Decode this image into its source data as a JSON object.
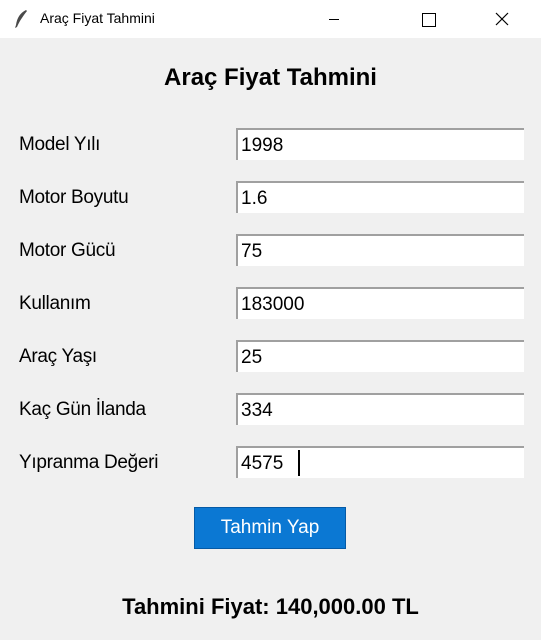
{
  "window": {
    "title": "Araç Fiyat Tahmini",
    "controls": [
      "minimize-icon",
      "maximize-icon",
      "close-icon"
    ]
  },
  "heading": "Araç Fiyat Tahmini",
  "fields": [
    {
      "label": "Model Yılı",
      "value": "1998"
    },
    {
      "label": "Motor Boyutu",
      "value": "1.6"
    },
    {
      "label": "Motor Gücü",
      "value": "75"
    },
    {
      "label": "Kullanım",
      "value": "183000"
    },
    {
      "label": "Araç Yaşı",
      "value": "25"
    },
    {
      "label": "Kaç Gün İlanda",
      "value": "334"
    },
    {
      "label": "Yıpranma Değeri",
      "value": "4575"
    }
  ],
  "button": {
    "label": "Tahmin Yap",
    "color": "#0b78d3"
  },
  "result": "Tahmini Fiyat: 140,000.00 TL"
}
